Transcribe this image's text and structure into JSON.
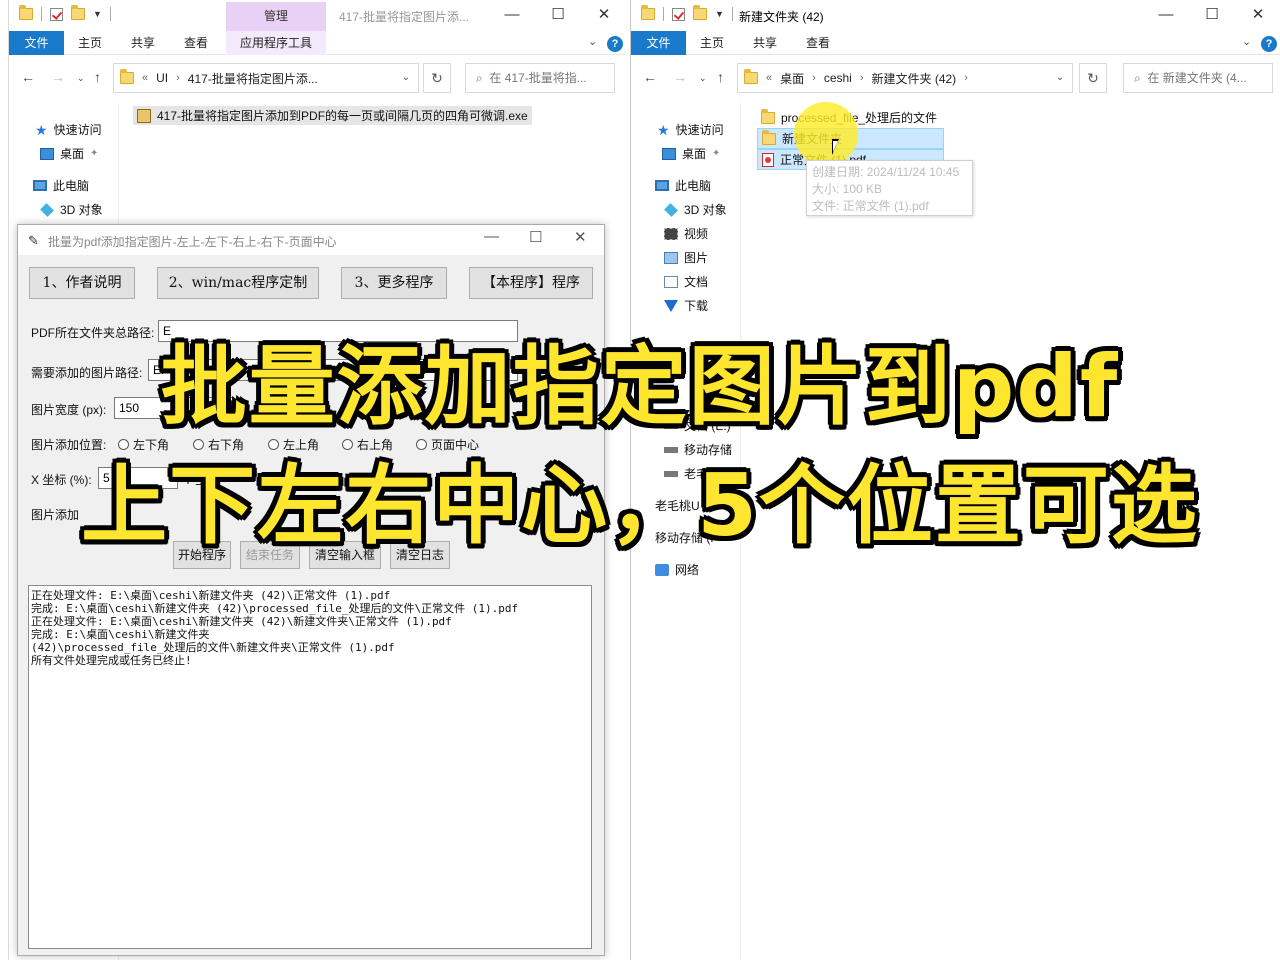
{
  "left_explorer": {
    "title": "417-批量将指定图片添...",
    "manage_tab": "管理",
    "ribbon_tabs": [
      "文件",
      "主页",
      "共享",
      "查看",
      "应用程序工具"
    ],
    "address": {
      "prefix": "«",
      "parts": [
        "UI",
        "417-批量将指定图片添..."
      ]
    },
    "search_placeholder": "在 417-批量将指...",
    "nav": {
      "quick_access": "快速访问",
      "desktop": "桌面",
      "this_pc": "此电脑",
      "objects3d": "3D 对象"
    },
    "files": [
      "417-批量将指定图片添加到PDF的每一页或间隔几页的四角可微调.exe"
    ]
  },
  "right_explorer": {
    "title": "新建文件夹 (42)",
    "ribbon_tabs": [
      "文件",
      "主页",
      "共享",
      "查看"
    ],
    "address": {
      "prefix": "«",
      "parts": [
        "桌面",
        "ceshi",
        "新建文件夹 (42)"
      ]
    },
    "search_placeholder": "在 新建文件夹 (4...",
    "nav": {
      "quick_access": "快速访问",
      "desktop": "桌面",
      "this_pc": "此电脑",
      "objects3d": "3D 对象",
      "videos": "视频",
      "pictures": "图片",
      "documents": "文档",
      "downloads": "下载",
      "doc_drive": "文档 (E:)",
      "removable1": "移动存储",
      "usb1": "老毛桃U",
      "usb2": "老毛桃U",
      "removable2": "移动存储 (F",
      "network": "网络"
    },
    "files": [
      "processed_file_处理后的文件",
      "新建文件夹",
      "正常文件 (1).pdf"
    ],
    "tooltip": [
      "创建日期: 2024/11/24 10:45",
      "大小: 100 KB",
      "文件: 正常文件 (1).pdf"
    ]
  },
  "app": {
    "title": "批量为pdf添加指定图片-左上-左下-右上-右下-页面中心",
    "top_buttons": [
      "1、作者说明",
      "2、win/mac程序定制",
      "3、更多程序",
      "【本程序】程序"
    ],
    "labels": {
      "pdf_folder": "PDF所在文件夹总路径:",
      "image_path": "需要添加的图片路径:",
      "width": "图片宽度 (px):",
      "position": "图片添加位置:",
      "x": "X 坐标 (%):",
      "y": "Y 坐",
      "add_mode": "图片添加"
    },
    "values": {
      "pdf_folder": "E",
      "image_path": "E:",
      "width": "150",
      "x": "5"
    },
    "radios": [
      "左下角",
      "右下角",
      "左上角",
      "右上角",
      "页面中心"
    ],
    "actions": [
      "开始程序",
      "结束任务",
      "清空输入框",
      "清空日志"
    ],
    "log": [
      "正在处理文件: E:\\桌面\\ceshi\\新建文件夹 (42)\\正常文件 (1).pdf",
      "完成: E:\\桌面\\ceshi\\新建文件夹 (42)\\processed_file_处理后的文件\\正常文件 (1).pdf",
      "正在处理文件: E:\\桌面\\ceshi\\新建文件夹 (42)\\新建文件夹\\正常文件 (1).pdf",
      "完成: E:\\桌面\\ceshi\\新建文件夹",
      "(42)\\processed_file_处理后的文件\\新建文件夹\\正常文件 (1).pdf",
      "所有文件处理完成或任务已终止!"
    ]
  },
  "overlay": {
    "line1": "批量添加指定图片到pdf",
    "line2": "上下左右中心，5个位置可选"
  }
}
